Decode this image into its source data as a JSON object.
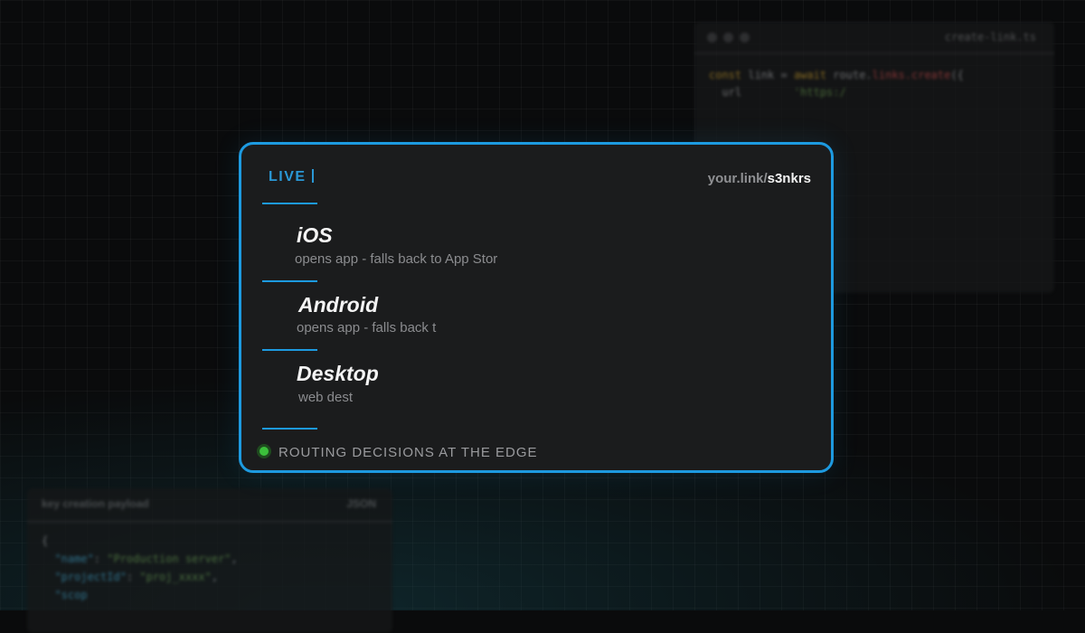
{
  "background": {
    "top_editor": {
      "filename": "create-link.ts",
      "code": [
        {
          "t": "const",
          "c": "k"
        },
        {
          "t": " link ",
          "c": "w"
        },
        {
          "t": "=",
          "c": "w"
        },
        {
          "t": " await ",
          "c": "k"
        },
        {
          "t": "route.",
          "c": "w"
        },
        {
          "t": "links.create",
          "c": "r"
        },
        {
          "t": "({",
          "c": "w"
        }
      ],
      "code_line2": [
        {
          "t": "  url",
          "c": "w"
        },
        {
          "t": "        'https:/",
          "c": "s"
        }
      ]
    },
    "bottom_editor": {
      "title": "key creation payload",
      "format": "JSON",
      "lines": [
        [
          {
            "t": "{",
            "c": "w"
          }
        ],
        [
          {
            "t": "  \"name\"",
            "c": "b"
          },
          {
            "t": ": ",
            "c": "w"
          },
          {
            "t": "\"Production server\"",
            "c": "s"
          },
          {
            "t": ",",
            "c": "w"
          }
        ],
        [
          {
            "t": "  \"projectId\"",
            "c": "b"
          },
          {
            "t": ": ",
            "c": "w"
          },
          {
            "t": "\"proj_xxxx\"",
            "c": "s"
          },
          {
            "t": ",",
            "c": "w"
          }
        ],
        [
          {
            "t": "  \"scop",
            "c": "b"
          }
        ]
      ]
    }
  },
  "card": {
    "live_label": "LIVE",
    "url_prefix": "your.link/",
    "url_slug": "s3nkrs",
    "routes": [
      {
        "platform": "iOS",
        "description": "opens app - falls back to App Stor"
      },
      {
        "platform": "Android",
        "description": "opens app - falls back t"
      },
      {
        "platform": "Desktop",
        "description": "web dest"
      }
    ],
    "status_text": "ROUTING DECISIONS AT THE EDGE"
  },
  "colors": {
    "accent": "#1d9ae0",
    "status_green": "#3bbf3b"
  }
}
